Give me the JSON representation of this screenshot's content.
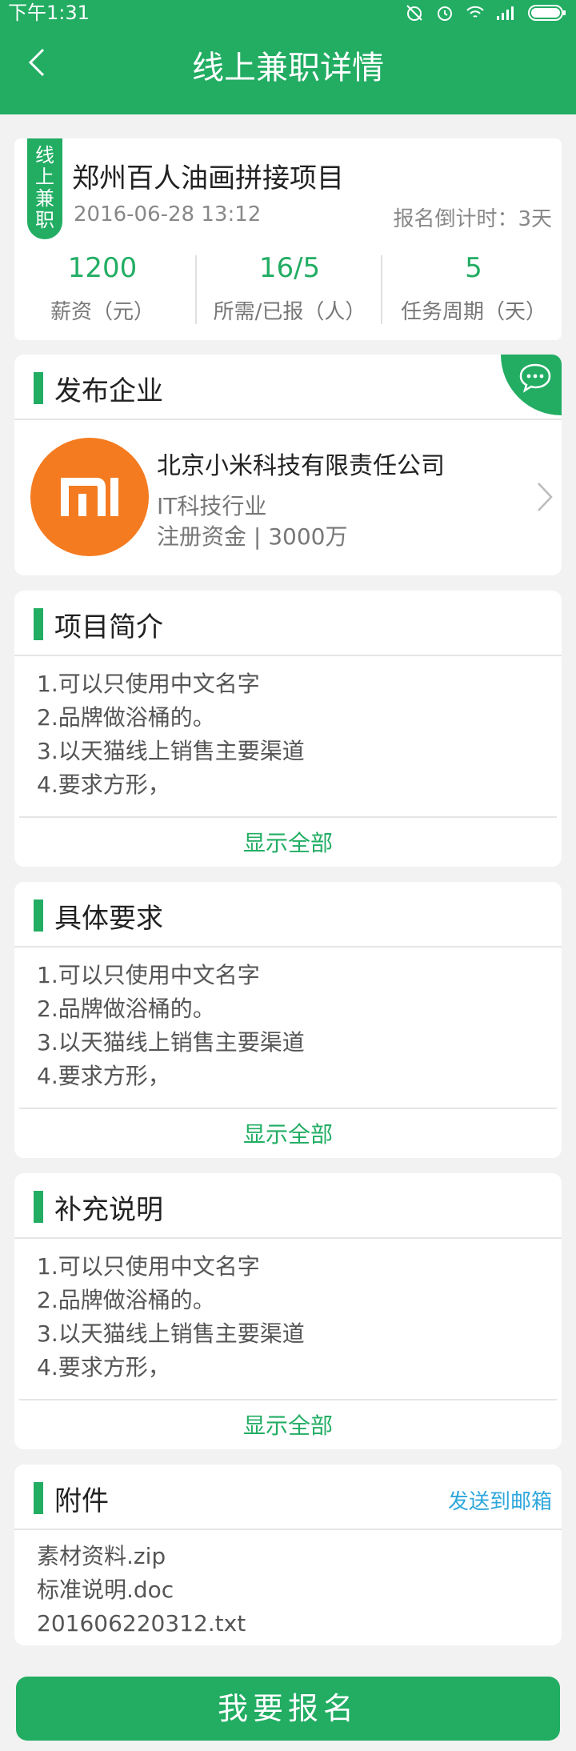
{
  "status_bar": {
    "time": "下午1:31"
  },
  "header": {
    "title": "线上兼职详情"
  },
  "job": {
    "tag": "线上兼职",
    "title": "郑州百人油画拼接项目",
    "date": "2016-06-28 13:12",
    "countdown": "报名倒计时：3天",
    "stats": [
      {
        "value": "1200",
        "label": "薪资（元）"
      },
      {
        "value": "16/5",
        "label": "所需/已报（人）"
      },
      {
        "value": "5",
        "label": "任务周期（天）"
      }
    ]
  },
  "company": {
    "section_title": "发布企业",
    "name": "北京小米科技有限责任公司",
    "industry": "IT科技行业",
    "capital": "注册资金 | 3000万"
  },
  "intro": {
    "section_title": "项目简介",
    "items": [
      "1.可以只使用中文名字",
      "2.品牌做浴桶的。",
      "3.以天猫线上销售主要渠道",
      "4.要求方形，"
    ],
    "show_all": "显示全部"
  },
  "requirements": {
    "section_title": "具体要求",
    "items": [
      "1.可以只使用中文名字",
      "2.品牌做浴桶的。",
      "3.以天猫线上销售主要渠道",
      "4.要求方形，"
    ],
    "show_all": "显示全部"
  },
  "notes": {
    "section_title": "补充说明",
    "items": [
      "1.可以只使用中文名字",
      "2.品牌做浴桶的。",
      "3.以天猫线上销售主要渠道",
      "4.要求方形，"
    ],
    "show_all": "显示全部"
  },
  "attachments": {
    "section_title": "附件",
    "send_email": "发送到邮箱",
    "files": [
      "素材资料.zip",
      "标准说明.doc",
      "201606220312.txt"
    ]
  },
  "footer": {
    "signup_label": "我要报名"
  },
  "colors": {
    "accent": "#22ad63",
    "logo": "#f47b20",
    "link": "#2fa7dc"
  }
}
